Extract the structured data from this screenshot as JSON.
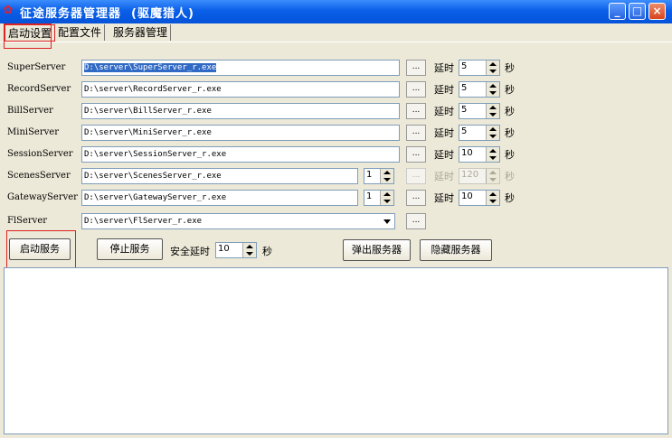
{
  "window": {
    "title": "征途服务器管理器  (驱魔猎人)",
    "icon": "app-icon",
    "controls": {
      "minimize": "_",
      "maximize": "□",
      "close": "×"
    }
  },
  "tabs": [
    {
      "label": "启动设置",
      "active": true
    },
    {
      "label": "配置文件",
      "active": false
    },
    {
      "label": "服务器管理",
      "active": false
    }
  ],
  "servers": [
    {
      "name": "SuperServer",
      "path": "D:\\server\\SuperServer_r.exe",
      "browse": "...",
      "delay_label": "延时",
      "delay": "5",
      "unit": "秒"
    },
    {
      "name": "RecordServer",
      "path": "D:\\server\\RecordServer_r.exe",
      "browse": "...",
      "delay_label": "延时",
      "delay": "5",
      "unit": "秒"
    },
    {
      "name": "BillServer",
      "path": "D:\\server\\BillServer_r.exe",
      "browse": "...",
      "delay_label": "延时",
      "delay": "5",
      "unit": "秒"
    },
    {
      "name": "MiniServer",
      "path": "D:\\server\\MiniServer_r.exe",
      "browse": "...",
      "delay_label": "延时",
      "delay": "5",
      "unit": "秒"
    },
    {
      "name": "SessionServer",
      "path": "D:\\server\\SessionServer_r.exe",
      "browse": "...",
      "delay_label": "延时",
      "delay": "10",
      "unit": "秒"
    },
    {
      "name": "ScenesServer",
      "path": "D:\\server\\ScenesServer_r.exe",
      "count": "1",
      "browse": "...",
      "delay_label": "延时",
      "delay": "120",
      "unit": "秒"
    },
    {
      "name": "GatewayServer",
      "path": "D:\\server\\GatewayServer_r.exe",
      "count": "1",
      "browse": "...",
      "delay_label": "延时",
      "delay": "10",
      "unit": "秒"
    },
    {
      "name": "FlServer",
      "path": "D:\\server\\FlServer_r.exe",
      "browse": "..."
    }
  ],
  "actions": {
    "start": "启动服务",
    "stop": "停止服务",
    "safe_delay_label": "安全延时",
    "safe_delay": "10",
    "safe_delay_unit": "秒",
    "popup": "弹出服务器",
    "hide": "隐藏服务器"
  },
  "colors": {
    "title_bar": "#0a5fe8",
    "highlight_box": "#dd2222",
    "selection": "#316ac5"
  }
}
